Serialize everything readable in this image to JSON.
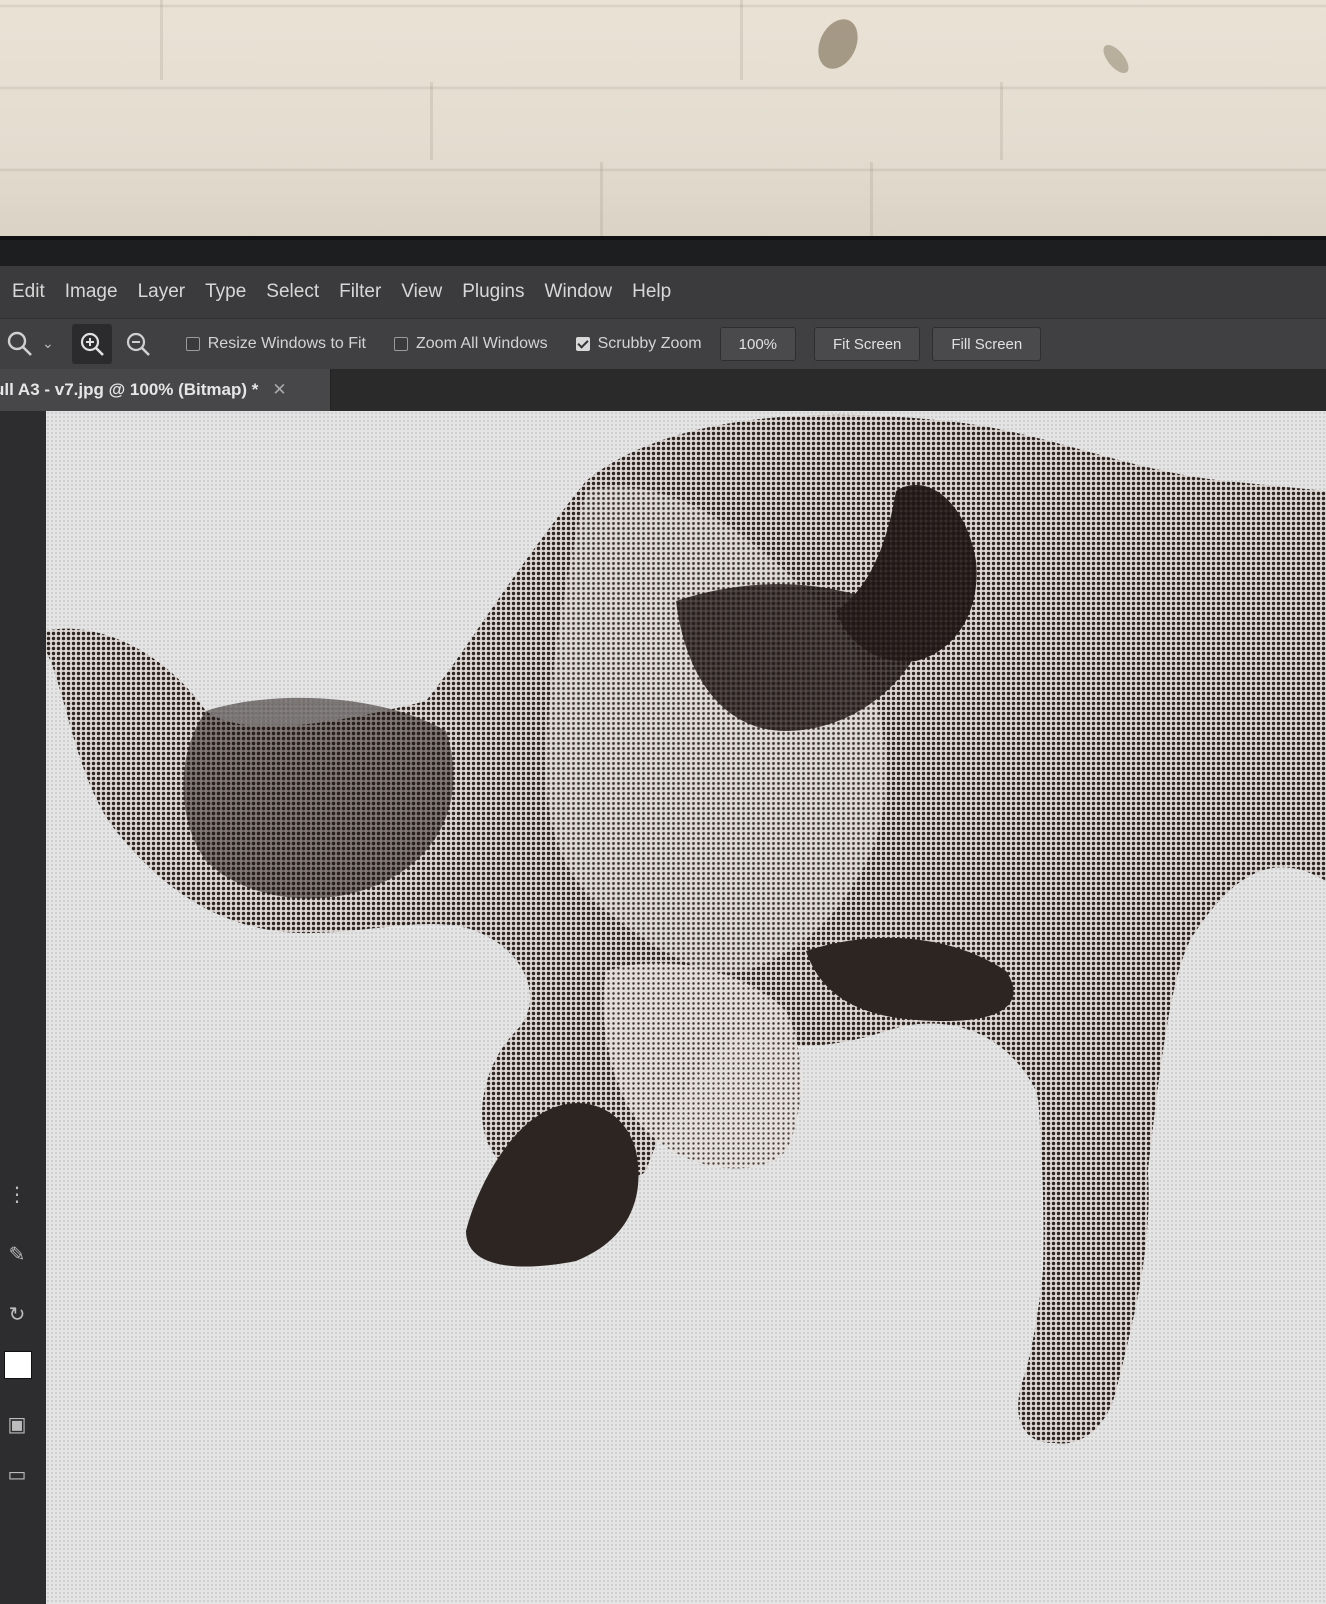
{
  "menu": [
    "Edit",
    "Image",
    "Layer",
    "Type",
    "Select",
    "Filter",
    "View",
    "Plugins",
    "Window",
    "Help"
  ],
  "options": {
    "tool_icon": "zoom-tool-icon",
    "zoom_in_icon": "zoom-in-icon",
    "zoom_out_icon": "zoom-out-icon",
    "resize_windows_to_fit": {
      "label": "Resize Windows to Fit",
      "checked": false
    },
    "zoom_all_windows": {
      "label": "Zoom All Windows",
      "checked": false
    },
    "scrubby_zoom": {
      "label": "Scrubby Zoom",
      "checked": true
    },
    "zoom_level_button": "100%",
    "fit_screen_button": "Fit Screen",
    "fill_screen_button": "Fill Screen"
  },
  "document_tab": {
    "title": "ull A3 - v7.jpg @ 100% (Bitmap) *",
    "close_icon": "close-icon"
  },
  "colors": {
    "ui_dark": "#3b3b3d",
    "canvas_bg": "#e4e4e4",
    "halftone_ink": "#2c2522"
  }
}
